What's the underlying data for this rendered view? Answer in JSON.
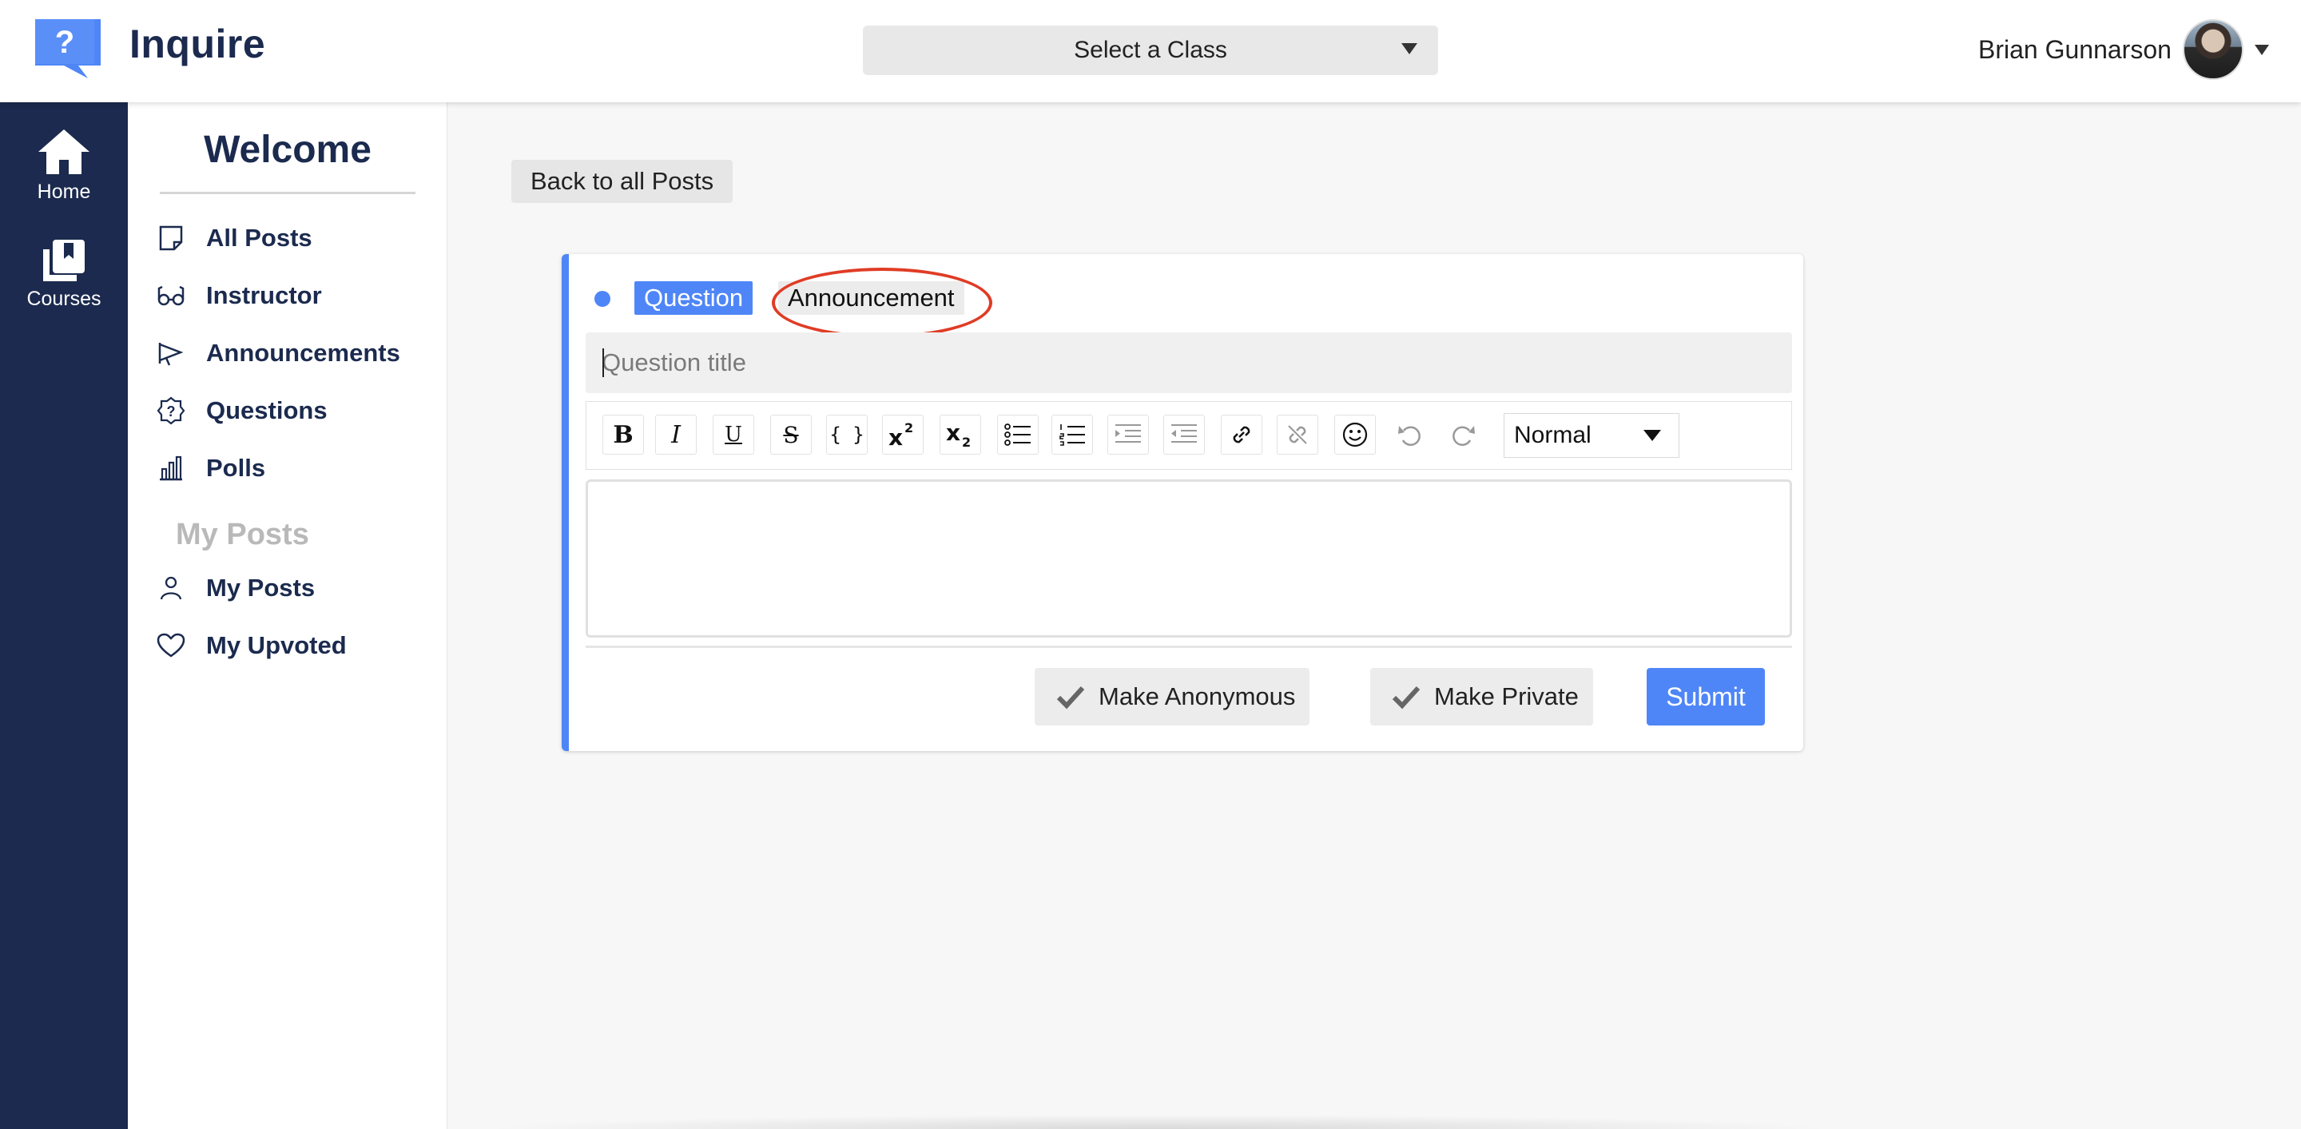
{
  "header": {
    "app_title": "Inquire",
    "logo_glyph": "?",
    "class_select": "Select a Class",
    "user_name": "Brian Gunnarson"
  },
  "rail": {
    "items": [
      {
        "label": "Home",
        "icon": "home-icon"
      },
      {
        "label": "Courses",
        "icon": "courses-icon"
      }
    ]
  },
  "sidenav": {
    "welcome": "Welcome",
    "items": [
      {
        "label": "All Posts",
        "icon": "note-icon"
      },
      {
        "label": "Instructor",
        "icon": "glasses-icon"
      },
      {
        "label": "Announcements",
        "icon": "megaphone-icon"
      },
      {
        "label": "Questions",
        "icon": "question-badge-icon"
      },
      {
        "label": "Polls",
        "icon": "bar-chart-icon"
      }
    ],
    "section_heading": "My Posts",
    "my_items": [
      {
        "label": "My Posts",
        "icon": "person-icon"
      },
      {
        "label": "My Upvoted",
        "icon": "heart-icon"
      }
    ]
  },
  "main": {
    "back_label": "Back to all Posts",
    "tabs": {
      "question": "Question",
      "announcement": "Announcement"
    },
    "title_placeholder": "Question title",
    "toolbar": {
      "bold": "B",
      "italic": "I",
      "underline": "U",
      "strike": "S",
      "code": "{ }",
      "format_select": "Normal"
    },
    "options": {
      "anonymous": "Make Anonymous",
      "private": "Make Private",
      "submit": "Submit"
    }
  },
  "colors": {
    "navy": "#1b2a4e",
    "accent_blue": "#4f86f7",
    "annotation_red": "#e03c25"
  }
}
